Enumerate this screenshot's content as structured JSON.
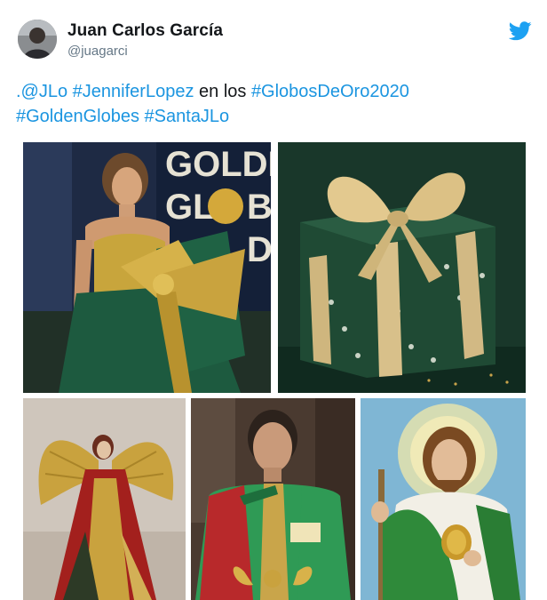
{
  "tweet": {
    "author_name": "Juan Carlos García",
    "author_handle": "@juagarci",
    "line1": [
      {
        "text": ".@JLo",
        "link": true
      },
      {
        "text": " ",
        "link": false
      },
      {
        "text": "#JenniferLopez",
        "link": true
      },
      {
        "text": " en los ",
        "link": false
      },
      {
        "text": "#GlobosDeOro2020",
        "link": true
      }
    ],
    "line2": [
      {
        "text": "#GoldenGlobes",
        "link": true
      },
      {
        "text": " ",
        "link": false
      },
      {
        "text": "#SantaJLo",
        "link": true
      }
    ]
  },
  "media": {
    "backdrop_text": "GOLDEN GLOBES",
    "sweater_tag": "",
    "images": [
      "photo-jlo-gown",
      "photo-gift-box",
      "photo-angel-figure",
      "photo-sweater-man",
      "photo-saint-jude"
    ]
  },
  "icons": {
    "brand": "twitter-bird-icon"
  },
  "colors": {
    "link": "#1b95e0",
    "name": "#14171a",
    "handle": "#657786",
    "twitter_blue": "#1da1f2",
    "gift_green": "#1f4a34",
    "gold": "#c9a94a"
  }
}
